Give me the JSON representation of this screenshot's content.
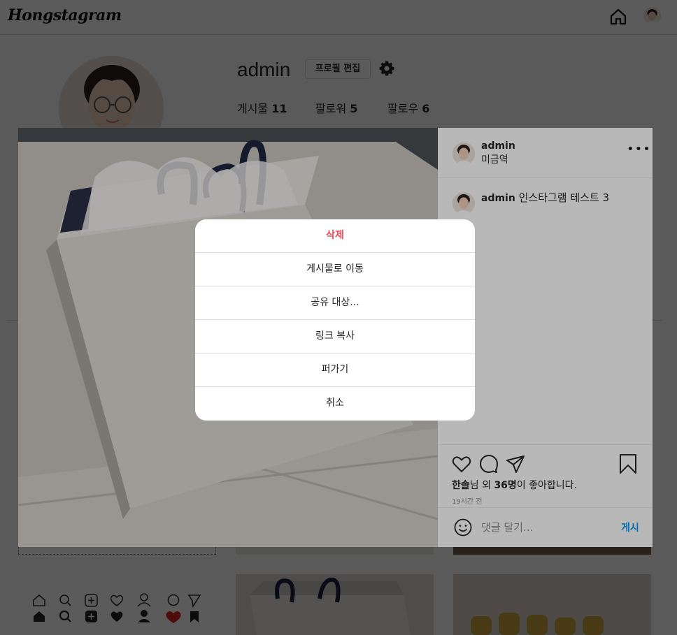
{
  "nav": {
    "logo": "Hongstagram",
    "home_icon": "home-icon",
    "avatar_icon": "avatar"
  },
  "profile": {
    "username": "admin",
    "edit_label": "프로필 편집",
    "settings_icon": "gear-icon",
    "stats": [
      {
        "label": "게시물",
        "value": "11"
      },
      {
        "label": "팔로워",
        "value": "5"
      },
      {
        "label": "팔로우",
        "value": "6"
      }
    ]
  },
  "post": {
    "author": "admin",
    "location": "미금역",
    "more_icon": "more-icon",
    "comment": {
      "user": "admin",
      "text": "인스타그램 테스트 3"
    },
    "likes": {
      "first": "한솔",
      "suffix_1": "님 외 ",
      "count": "36명",
      "suffix_2": "이 좋아합니다."
    },
    "time_ago": "19시간 전",
    "comment_placeholder": "댓글 달기...",
    "post_button": "게시",
    "action_icons": [
      "heart-icon",
      "comment-icon",
      "send-icon",
      "bookmark-icon"
    ]
  },
  "sheet": {
    "items": [
      {
        "label": "삭제",
        "danger": true
      },
      {
        "label": "게시물로 이동"
      },
      {
        "label": "공유 대상..."
      },
      {
        "label": "링크 복사"
      },
      {
        "label": "퍼가기"
      },
      {
        "label": "취소"
      }
    ]
  },
  "colors": {
    "danger": "#ed4956",
    "link": "#0095f6",
    "border": "#dbdbdb",
    "overlay": "rgba(0,0,0,0.5)"
  }
}
